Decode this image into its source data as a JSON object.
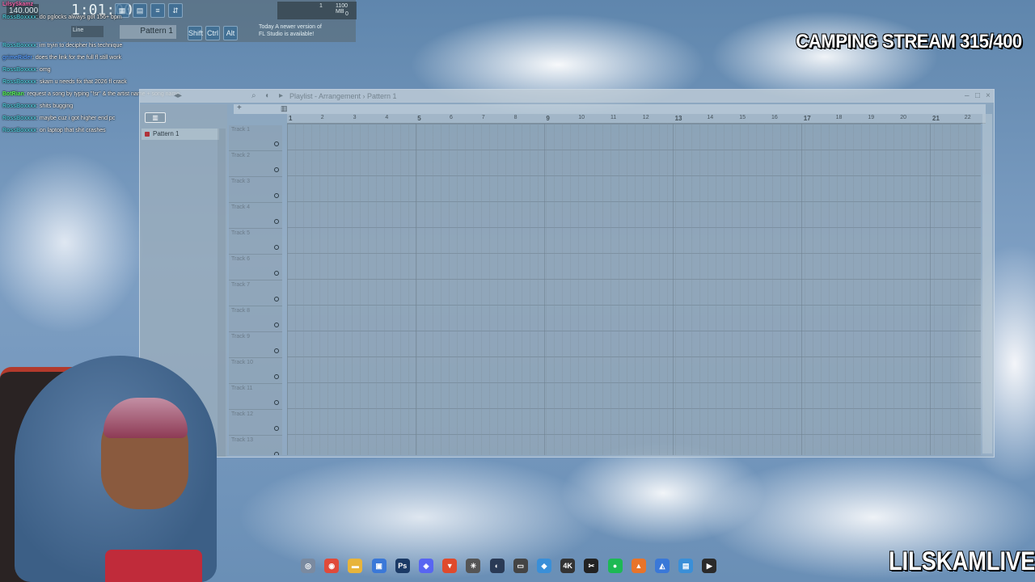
{
  "toolbar": {
    "tempo": "140.000",
    "time": "1:01:00",
    "pattern": "Pattern 1",
    "snap": "Line",
    "cpu_value": "1",
    "memory": "1100 MB",
    "voices": "0",
    "news_line1": "Today  A newer version of",
    "news_line2": "FL Studio is available!",
    "buttons": [
      "Shift",
      "Ctrl",
      "Alt"
    ]
  },
  "chat": [
    {
      "user": "LilsySkamz",
      "text": ""
    },
    {
      "user": "RossBoxxxx",
      "text": ": do pglocks always got 156+ bpm"
    },
    {
      "user": "RossBoxxxx",
      "text": ": im tryin to decipher his technique"
    },
    {
      "user": "grimeRider",
      "text": ": does the link for the full fl still work"
    },
    {
      "user": "RossBoxxxx",
      "text": ": omg"
    },
    {
      "user": "RossBoxxxx",
      "text": ": skam u needs fix that 2026 fl crack"
    },
    {
      "user": "BotRian",
      "text": ": request a song by typing \"!sr\" & the artist name + song name"
    },
    {
      "user": "RossBoxxxx",
      "text": ": shits bugging"
    },
    {
      "user": "RossBoxxxx",
      "text": ": maybe cuz i got higher end pc"
    },
    {
      "user": "RossBoxxxx",
      "text": ": on laptop that shit crashes"
    }
  ],
  "stream_title": "CAMPING STREAM 315/400",
  "brand": "LILSKAMLIVE",
  "playlist": {
    "title": "Playlist - Arrangement › Pattern 1",
    "pattern_item": "Pattern 1",
    "tracks": [
      "Track 1",
      "Track 2",
      "Track 3",
      "Track 4",
      "Track 5",
      "Track 6",
      "Track 7",
      "Track 8",
      "Track 9",
      "Track 10",
      "Track 11",
      "Track 12",
      "Track 13"
    ],
    "bar_numbers": [
      "1",
      "2",
      "3",
      "4",
      "5",
      "6",
      "7",
      "8",
      "9",
      "10",
      "11",
      "12",
      "13",
      "14",
      "15",
      "16",
      "17",
      "18",
      "19",
      "20",
      "21",
      "22"
    ]
  },
  "taskbar_icons": [
    "fl-studio-icon",
    "chrome-icon",
    "folder-icon",
    "store-icon",
    "photoshop-icon",
    "discord-icon",
    "brave-icon",
    "app-icon",
    "steam-icon",
    "app-icon",
    "folder-icon",
    "4k-icon",
    "capcut-icon",
    "spotify-icon",
    "fl-studio-icon",
    "app-icon",
    "notepad-icon",
    "media-icon"
  ]
}
